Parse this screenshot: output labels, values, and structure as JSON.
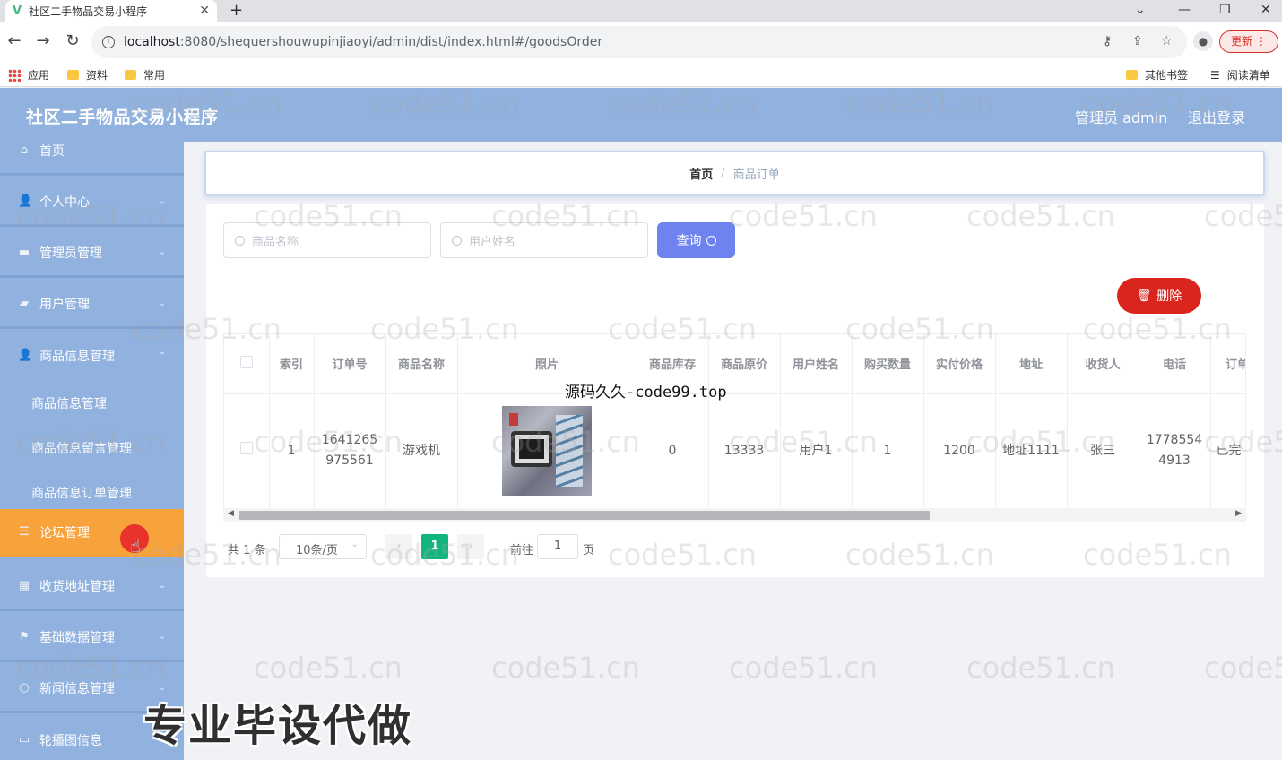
{
  "browser": {
    "tab_title": "社区二手物品交易小程序",
    "url_host": "localhost",
    "url_path": ":8080/shequershouwupinjiaoyi/admin/dist/index.html#/goodsOrder",
    "update_label": "更新",
    "bookmarks": [
      "应用",
      "资料",
      "常用"
    ],
    "bookmarks_right": [
      "其他书签",
      "阅读清单"
    ]
  },
  "header": {
    "title": "社区二手物品交易小程序",
    "user": "管理员 admin",
    "logout": "退出登录"
  },
  "sidebar": {
    "items": [
      {
        "label": "首页",
        "icon": "home-icon"
      },
      {
        "label": "个人中心",
        "icon": "user-icon"
      },
      {
        "label": "管理员管理",
        "icon": "briefcase-icon"
      },
      {
        "label": "用户管理",
        "icon": "ticket-icon"
      },
      {
        "label": "商品信息管理",
        "icon": "user-icon"
      },
      {
        "label": "论坛管理",
        "icon": "list-icon"
      },
      {
        "label": "收货地址管理",
        "icon": "grid-icon"
      },
      {
        "label": "基础数据管理",
        "icon": "flag-icon"
      },
      {
        "label": "新闻信息管理",
        "icon": "circle-icon"
      },
      {
        "label": "轮播图信息",
        "icon": "monitor-icon"
      }
    ],
    "subitems": [
      "商品信息管理",
      "商品信息留言管理",
      "商品信息订单管理"
    ]
  },
  "breadcrumb": {
    "home": "首页",
    "separator": "/",
    "current": "商品订单"
  },
  "search": {
    "goods_placeholder": "商品名称",
    "user_placeholder": "用户姓名",
    "query_label": "查询"
  },
  "actions": {
    "delete_label": "删除"
  },
  "table": {
    "headers": [
      "索引",
      "订单号",
      "商品名称",
      "照片",
      "商品库存",
      "商品原价",
      "用户姓名",
      "购买数量",
      "实付价格",
      "地址",
      "收货人",
      "电话",
      "订单"
    ],
    "rows": [
      {
        "index": "1",
        "order_no": "1641265975561",
        "goods_name": "游戏机",
        "stock": "0",
        "orig_price": "13333",
        "user_name": "用户1",
        "qty": "1",
        "paid": "1200",
        "address": "地址1111",
        "receiver": "张三",
        "phone": "17785544913",
        "status": "已完"
      }
    ]
  },
  "pagination": {
    "total": "共 1 条",
    "page_size": "10条/页",
    "current_page": "1",
    "goto": "前往",
    "goto_value": "1",
    "page_suffix": "页"
  },
  "watermark": "code51.cn",
  "overlay_code": "源码久久-code99.top",
  "overlay_big": "专业毕设代做",
  "colors": {
    "header_bg": "#91b1de",
    "active_menu": "#f7a23b",
    "query_btn": "#6e83ef",
    "delete_btn": "#d9251d",
    "page_active": "#13b57f"
  }
}
